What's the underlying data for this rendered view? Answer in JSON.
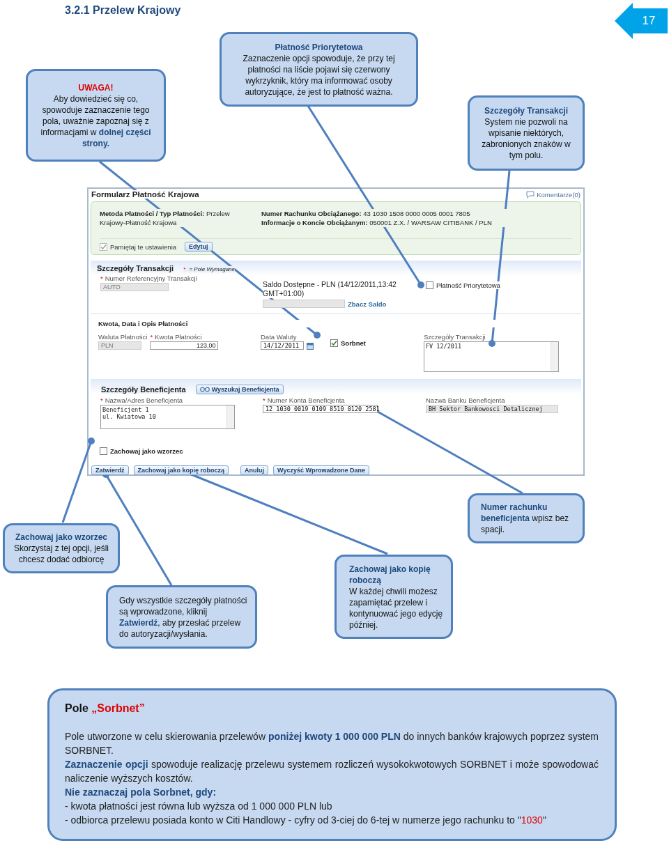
{
  "heading": "3.2.1 Przelew Krajowy",
  "page_number": "17",
  "callouts": [
    {
      "kind": "warning",
      "title": "UWAGA!",
      "text": "Aby dowiedzieć się co, spowoduje zaznaczenie tego pola, uważnie zapoznaj się z informacjami w **dolnej części strony.**"
    },
    {
      "kind": "info",
      "title": "Płatność Priorytetowa",
      "text": "Zaznaczenie opcji spowoduje, że przy tej płatności na liście pojawi się czerwony wykrzyknik, który ma informować osoby autoryzujące, że jest to płatność ważna."
    },
    {
      "kind": "info",
      "title": "Szczegóły Transakcji",
      "text": "System nie pozwoli na wpisanie niektórych, zabronionych znaków w tym polu."
    },
    {
      "kind": "info",
      "title": "Zachowaj jako wzorzec",
      "text": "Skorzystaj z tej opcji, jeśli chcesz dodać odbiorcę"
    },
    {
      "kind": "info",
      "text": "Gdy wszystkie szczegóły płatności są wprowadzone, kliknij **Zatwierdź**, aby przesłać przelew do autoryzacji/wysłania."
    },
    {
      "kind": "info",
      "title": "Zachowaj jako kopię roboczą",
      "text": "W każdej chwili możesz zapamiętać przelew i kontynuować jego edycję później."
    },
    {
      "kind": "info",
      "text": "**Numer rachunku beneficjenta** wpisz bez spacji."
    }
  ],
  "form": {
    "title": "Formularz Płatność Krajowa",
    "comments": "Komentarze(0)",
    "summary": [
      {
        "label": "Metoda Płatności / Typ Płatności:",
        "value": "Przelew Krajowy-Płatność Krajowa"
      },
      {
        "label": "Numer Rachunku Obciążanego:",
        "value": "43 1030 1508 0000 0005 0001 7805"
      },
      {
        "label": "Informacje o Koncie Obciążanym:",
        "value": "050001 Z.X. / WARSAW CITIBANK / PLN"
      }
    ],
    "remember": {
      "label": "Pamiętaj te ustawienia",
      "checked": true,
      "disabled": true
    },
    "edit_button": "Edytuj",
    "transaction": {
      "title": "Szczegóły Transakcji",
      "required_mark": "*",
      "required_note": "= Pole Wymagane",
      "reference": {
        "label": "Numer Referencyjny Transakcji",
        "required": true,
        "value": "AUTO",
        "disabled": true
      },
      "balance": {
        "label": "Saldo Dostępne - PLN (14/12/2011,13:42 GMT+01:00)",
        "link": "Zbacz Saldo"
      },
      "priority": {
        "label": "Płatność Priorytetowa",
        "checked": false
      }
    },
    "amount_section": {
      "title": "Kwota, Data i Opis Płatności",
      "currency": {
        "label": "Waluta Płatności",
        "value": "PLN",
        "disabled": true
      },
      "amount": {
        "label": "Kwota Płatności",
        "required": true,
        "value": "123,00"
      },
      "date": {
        "label": "Data Waluty",
        "value": "14/12/2011"
      },
      "sorbnet": {
        "label": "Sorbnet",
        "checked": true
      },
      "details": {
        "label": "Szczegóły Transakcji",
        "value": "FV 12/2011"
      }
    },
    "beneficiary": {
      "title": "Szczegóły Beneficjenta",
      "search_button": "Wyszukaj Beneficjenta",
      "name": {
        "label": "Nazwa/Adres Beneficjenta",
        "required": true,
        "value": "Beneficjent 1\nul. Kwiatowa 10"
      },
      "account": {
        "label": "Numer Konta Beneficjenta",
        "required": true,
        "value": "12 1030 0019 0109 8510 0120 2581"
      },
      "bank": {
        "label": "Nazwa Banku Beneficjenta",
        "value": "BH Sektor Bankowosci Detalicznej",
        "disabled": true
      }
    },
    "template": {
      "label": "Zachowaj jako wzorzec",
      "checked": false
    },
    "buttons": [
      "Zatwierdź",
      "Zachowaj jako kopię roboczą",
      "Anuluj",
      "Wyczyść Wprowadzone Dane"
    ]
  },
  "info_box": {
    "title": "Pole",
    "title_highlight": "„Sorbnet”",
    "paragraphs": [
      "Pole utworzone w celu skierowania przelewów **poniżej kwoty 1 000 000 PLN** do innych banków krajowych poprzez system SORBNET.",
      "**Zaznaczenie opcji** spowoduje realizację przelewu systemem rozliczeń wysokokwotowych SORBNET i może spowodować naliczenie wyższych kosztów."
    ],
    "list_title": "Nie zaznaczaj pola Sorbnet, gdy:",
    "items": [
      {
        "text": "- kwota płatności jest równa lub wyższa od 1 000 000 PLN lub"
      },
      {
        "text": "- odbiorca przelewu posiada konto w Citi Handlowy - cyfry od 3-ciej do 6-tej w numerze jego rachunku to \"",
        "highlight": "1030",
        "tail": "\""
      }
    ]
  }
}
